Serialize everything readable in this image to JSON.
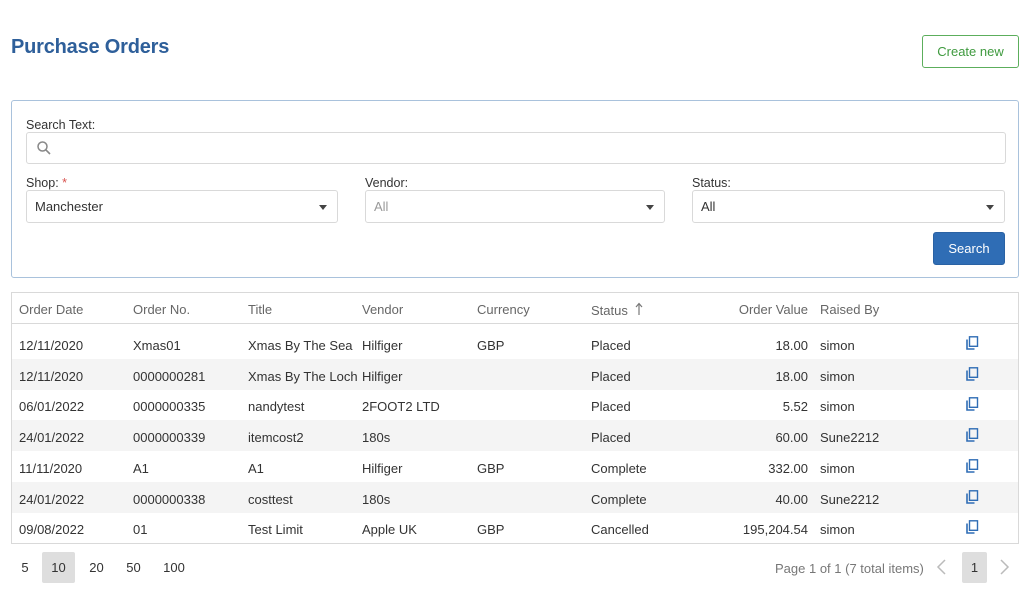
{
  "header": {
    "title": "Purchase Orders",
    "create_label": "Create new"
  },
  "filters": {
    "search_label": "Search Text:",
    "search_value": "",
    "shop_label": "Shop:",
    "shop_required": "*",
    "shop_value": "Manchester",
    "vendor_label": "Vendor:",
    "vendor_value": "All",
    "status_label": "Status:",
    "status_value": "All",
    "search_button": "Search"
  },
  "grid": {
    "columns": [
      "Order Date",
      "Order No.",
      "Title",
      "Vendor",
      "Currency",
      "Status",
      "Order Value",
      "Raised By"
    ],
    "sorted_column": "Status",
    "rows": [
      [
        "12/11/2020",
        "Xmas01",
        "Xmas By The Sea",
        "Hilfiger",
        "GBP",
        "Placed",
        "18.00",
        "simon"
      ],
      [
        "12/11/2020",
        "0000000281",
        "Xmas By The Loch",
        "Hilfiger",
        "",
        "Placed",
        "18.00",
        "simon"
      ],
      [
        "06/01/2022",
        "0000000335",
        "nandytest",
        "2FOOT2 LTD",
        "",
        "Placed",
        "5.52",
        "simon"
      ],
      [
        "24/01/2022",
        "0000000339",
        "itemcost2",
        "180s",
        "",
        "Placed",
        "60.00",
        "Sune2212"
      ],
      [
        "11/11/2020",
        "A1",
        "A1",
        "Hilfiger",
        "GBP",
        "Complete",
        "332.00",
        "simon"
      ],
      [
        "24/01/2022",
        "0000000338",
        "costtest",
        "180s",
        "",
        "Complete",
        "40.00",
        "Sune2212"
      ],
      [
        "09/08/2022",
        "01",
        "Test Limit",
        "Apple UK",
        "GBP",
        "Cancelled",
        "195,204.54",
        "simon"
      ]
    ]
  },
  "pager": {
    "sizes": [
      "5",
      "10",
      "20",
      "50",
      "100"
    ],
    "active_size": "10",
    "info": "Page 1 of 1 (7 total items)",
    "current_page": "1"
  },
  "colors": {
    "title": "#2e5f9a",
    "primary": "#2f6db5",
    "create_border": "#5cae5c",
    "row_alt": "#f4f4f4"
  },
  "icons": {
    "search": "search-icon",
    "sort": "sort-ascending-icon",
    "copy": "copy-icon",
    "prev": "chevron-left-icon",
    "next": "chevron-right-icon",
    "dropdown": "caret-down-icon"
  }
}
